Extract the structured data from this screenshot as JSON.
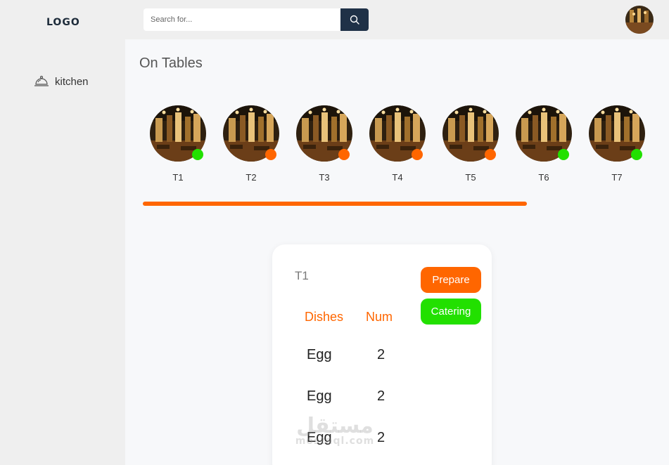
{
  "header": {
    "logo": "LOGO",
    "search_placeholder": "Search for..."
  },
  "sidebar": {
    "items": [
      {
        "label": "kitchen",
        "icon": "cloche-icon"
      }
    ]
  },
  "main": {
    "title": "On Tables",
    "tables": [
      {
        "label": "T1",
        "status_color": "#22e000"
      },
      {
        "label": "T2",
        "status_color": "#ff6600"
      },
      {
        "label": "T3",
        "status_color": "#ff6600"
      },
      {
        "label": "T4",
        "status_color": "#ff6600"
      },
      {
        "label": "T5",
        "status_color": "#ff6600"
      },
      {
        "label": "T6",
        "status_color": "#22e000"
      },
      {
        "label": "T7",
        "status_color": "#22e000"
      }
    ],
    "scroll_progress": 0.72
  },
  "order_card": {
    "title": "T1",
    "prepare_label": "Prepare",
    "catering_label": "Catering",
    "columns": [
      "Dishes",
      "Num"
    ],
    "rows": [
      {
        "dish": "Egg",
        "num": "2"
      },
      {
        "dish": "Egg",
        "num": "2"
      },
      {
        "dish": "Egg",
        "num": "2"
      }
    ]
  },
  "watermark": {
    "arabic": "مستقل",
    "latin": "mostaql.com"
  },
  "colors": {
    "accent_orange": "#ff6600",
    "accent_green": "#22e000",
    "search_button": "#1f3147"
  }
}
